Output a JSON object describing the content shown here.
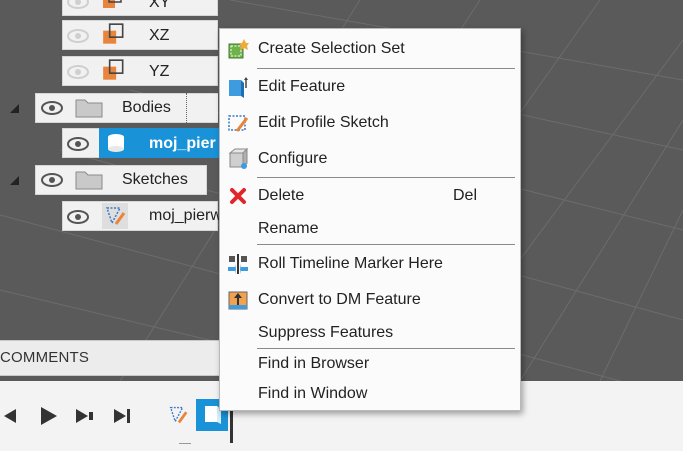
{
  "browser": {
    "planes": [
      {
        "label": "XY"
      },
      {
        "label": "XZ"
      },
      {
        "label": "YZ"
      }
    ],
    "bodies_folder": "Bodies",
    "body_item": "moj_pier",
    "sketches_folder": "Sketches",
    "sketch_item": "moj_pierw"
  },
  "comments": {
    "label": "COMMENTS"
  },
  "context_menu": {
    "items": [
      {
        "label": "Create Selection Set",
        "icon": "selection-set-icon"
      },
      {
        "label": "Edit Feature",
        "icon": "edit-feature-icon"
      },
      {
        "label": "Edit Profile Sketch",
        "icon": "edit-profile-sketch-icon"
      },
      {
        "label": "Configure",
        "icon": "configure-icon"
      },
      {
        "label": "Delete",
        "shortcut": "Del",
        "icon": "delete-icon"
      },
      {
        "label": "Rename"
      },
      {
        "label": "Roll Timeline Marker Here",
        "icon": "roll-timeline-icon"
      },
      {
        "label": "Convert to DM Feature",
        "icon": "convert-dm-icon"
      },
      {
        "label": "Suppress Features"
      },
      {
        "label": "Find in Browser"
      },
      {
        "label": "Find in Window"
      }
    ]
  },
  "colors": {
    "selection_blue": "#1a92d8",
    "delete_red": "#e0262b",
    "viewport_gray": "#5a5a5a"
  }
}
